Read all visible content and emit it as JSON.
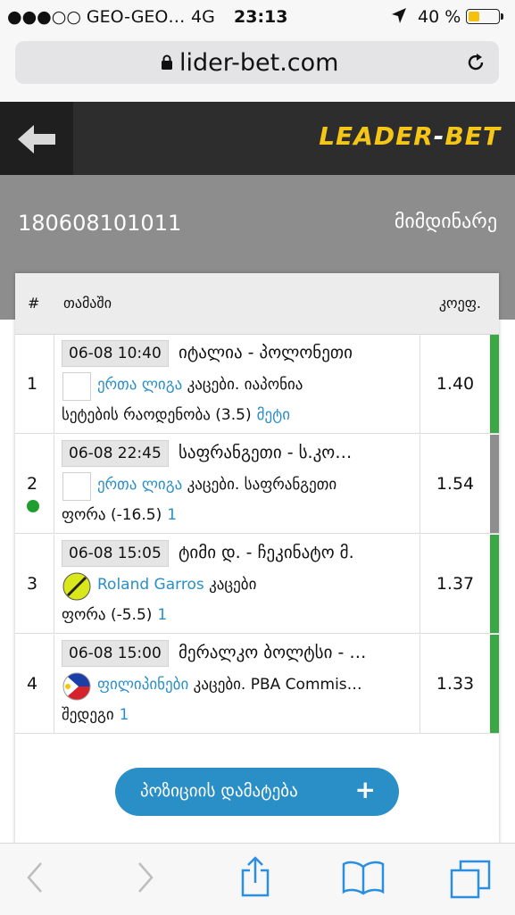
{
  "status_bar": {
    "carrier": "●●●○○ GEO-GEO…",
    "network": "4G",
    "time": "23:13",
    "battery_text": "40 %",
    "battery_level": 0.4,
    "battery_color": "#f4c20d"
  },
  "browser": {
    "url": "lider-bet.com"
  },
  "header": {
    "logo_main": "LEADER",
    "logo_dash": "-",
    "logo_accent": "BET",
    "logo_color": "#f5c518"
  },
  "ticket": {
    "id": "180608101011",
    "status": "მიმდინარე"
  },
  "table": {
    "col_num": "#",
    "col_game": "თამაში",
    "col_odd": "კოეფ.",
    "rows": [
      {
        "num": "1",
        "time": "06-08 10:40",
        "teams": "იტალია - პოლონეთი",
        "league": "ერთა ლიგა",
        "category": "კაცები. იაპონია",
        "market": "სეტების რაოდენობა (3.5)",
        "outcome": "მეტი",
        "odd": "1.40",
        "flag": "blank",
        "bar_color": "#3aa845",
        "live": false
      },
      {
        "num": "2",
        "time": "06-08 22:45",
        "teams": "საფრანგეთი - ს.კო…",
        "league": "ერთა ლიგა",
        "category": "კაცები. საფრანგეთი",
        "market": "ფორა (-16.5)",
        "outcome": "1",
        "odd": "1.54",
        "flag": "blank",
        "bar_color": "#8e8e8e",
        "live": true
      },
      {
        "num": "3",
        "time": "06-08 15:05",
        "teams": "ტიმი დ. - ჩეკინატო მ.",
        "league": "Roland Garros",
        "category": "კაცები",
        "market": "ფორა (-5.5)",
        "outcome": "1",
        "odd": "1.37",
        "flag": "tennis-ball",
        "bar_color": "#3aa845",
        "live": false
      },
      {
        "num": "4",
        "time": "06-08 15:00",
        "teams": "მერალკო ბოლტსი - …",
        "league": "ფილიპინები",
        "category": "კაცები. PBA Commis…",
        "market": "შედეგი",
        "outcome": "1",
        "odd": "1.33",
        "flag": "philippines-flag",
        "bar_color": "#3aa845",
        "live": false
      }
    ]
  },
  "add_button": {
    "label": "პოზიციის დამატება",
    "icon": "+"
  }
}
